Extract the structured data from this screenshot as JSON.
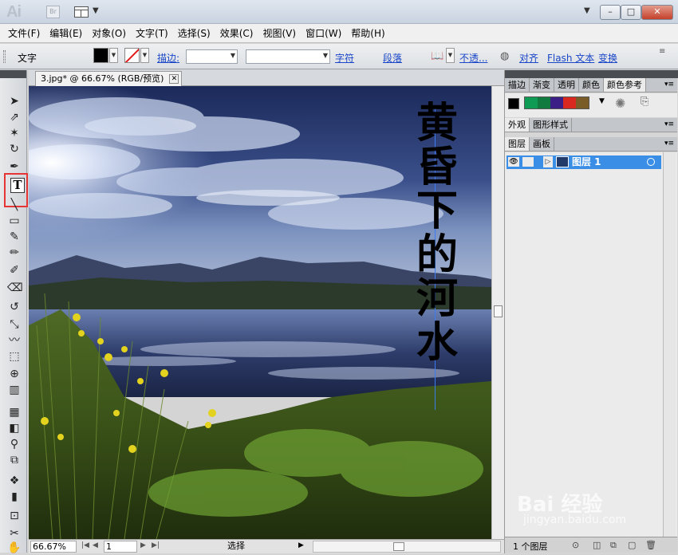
{
  "app": {
    "logo": "Ai",
    "bridge_label": "Br"
  },
  "menu": [
    "文件(F)",
    "编辑(E)",
    "对象(O)",
    "文字(T)",
    "选择(S)",
    "效果(C)",
    "视图(V)",
    "窗口(W)",
    "帮助(H)"
  ],
  "control_bar": {
    "tool_name": "文字",
    "stroke_label": "描边:",
    "char_label": "字符",
    "para_label": "段落",
    "opacity_label": "不透...",
    "align_label": "对齐",
    "flash_label": "Flash 文本",
    "transform_label": "变换",
    "fill_color": "#000000",
    "stroke_color": "none"
  },
  "document": {
    "tab_title": "3.jpg* @ 66.67% (RGB/预览)",
    "vertical_text": [
      "黄",
      "昏",
      "下",
      "的",
      "河",
      "水"
    ]
  },
  "status_bar": {
    "zoom": "66.67%",
    "page": "1",
    "mode": "选择"
  },
  "panels": {
    "top_tabs": [
      "描边",
      "渐变",
      "透明",
      "颜色",
      "颜色参考"
    ],
    "guide_colors": [
      "#000000",
      "#0f9b54",
      "#117a3e",
      "#3b1f86",
      "#d8281f",
      "#7a5c28"
    ],
    "appearance_tabs": [
      "外观",
      "图形样式"
    ],
    "layers_tabs": [
      "图层",
      "画板"
    ],
    "layer_name": "图层 1",
    "layer_count": "1 个图层"
  },
  "watermark": {
    "line1": "Bai 经验",
    "line2": "jingyan.baidu.com"
  }
}
